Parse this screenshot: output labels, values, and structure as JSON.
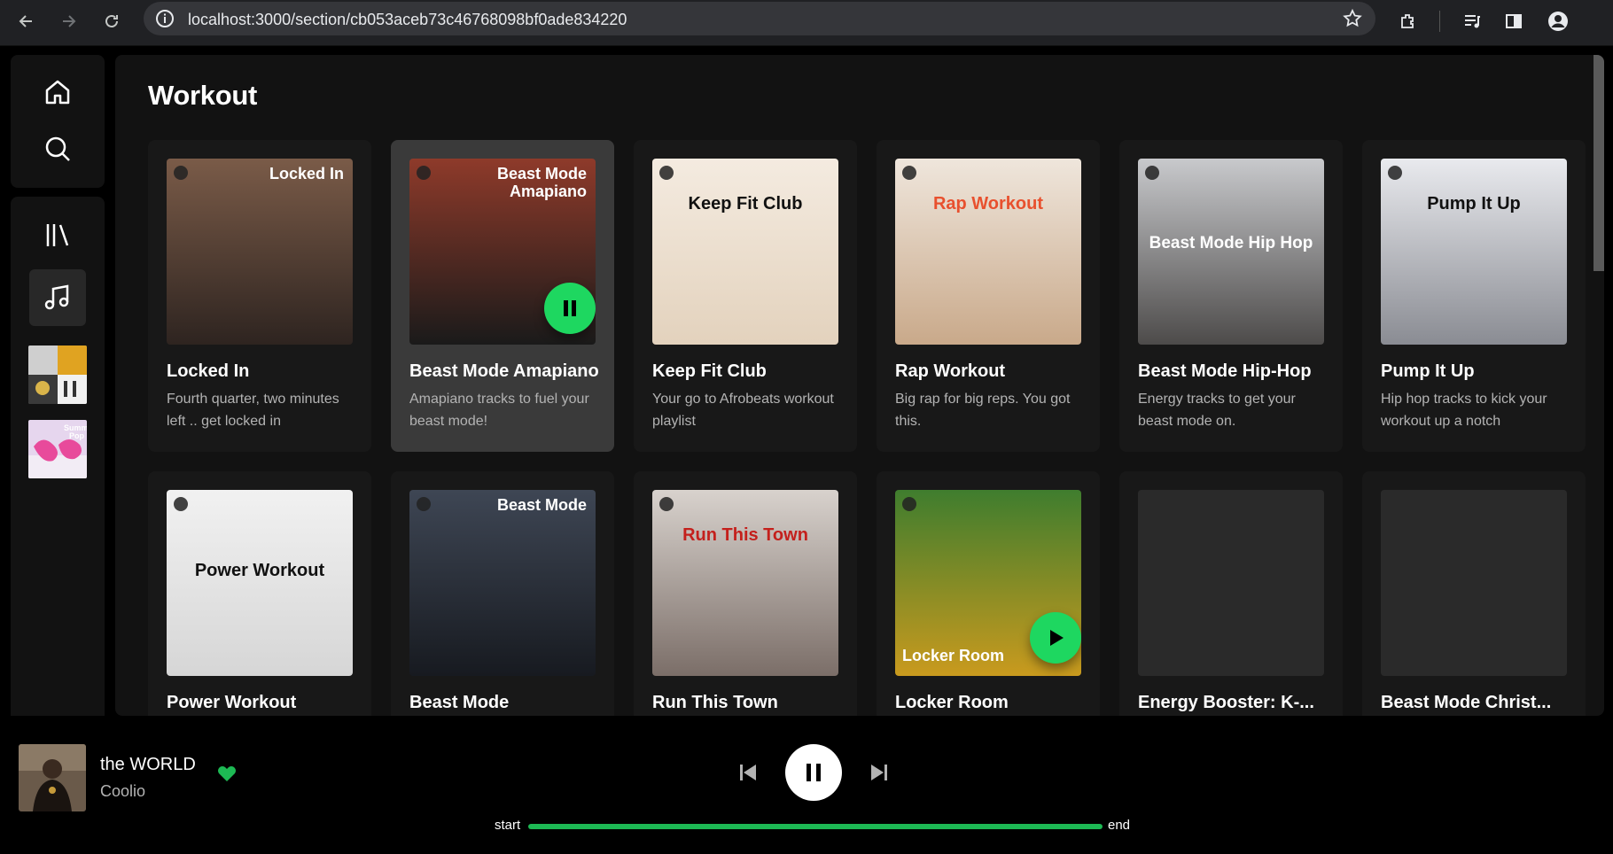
{
  "browser": {
    "url": "localhost:3000/section/cb053aceb73c46768098bf0ade834220"
  },
  "section": {
    "title": "Workout"
  },
  "cards": [
    {
      "name": "Locked In",
      "desc": "Fourth quarter, two minutes left .. get locked in",
      "art_text": "Locked In",
      "palette": [
        "#7a5b48",
        "#2e2420"
      ]
    },
    {
      "name": "Beast Mode Amapiano",
      "desc": "Amapiano tracks to fuel your beast mode!",
      "art_text": "Beast Mode Amapiano",
      "palette": [
        "#8e3a2a",
        "#1a1a1a"
      ]
    },
    {
      "name": "Keep Fit Club",
      "desc": "Your go to Afrobeats workout playlist",
      "art_text": "Keep Fit Club",
      "palette": [
        "#f4ebe0",
        "#e3d2bd"
      ]
    },
    {
      "name": "Rap Workout",
      "desc": "Big rap for big reps. You got this.",
      "art_text": "Rap Workout",
      "palette": [
        "#efe6dc",
        "#c9a98a"
      ]
    },
    {
      "name": "Beast Mode Hip-Hop",
      "desc": "Energy tracks to get your beast mode on.",
      "art_text": "Beast Mode Hip Hop",
      "palette": [
        "#c8c9cc",
        "#4d4b4a"
      ]
    },
    {
      "name": "Pump It Up",
      "desc": "Hip hop tracks to kick your workout up a notch",
      "art_text": "Pump It Up",
      "palette": [
        "#e9eaee",
        "#8a8c93"
      ]
    },
    {
      "name": "Power Workout",
      "desc": "",
      "art_text": "Power Workout",
      "palette": [
        "#f1f1f1",
        "#d6d6d6"
      ]
    },
    {
      "name": "Beast Mode",
      "desc": "",
      "art_text": "Beast Mode",
      "palette": [
        "#3e4654",
        "#171a20"
      ]
    },
    {
      "name": "Run This Town",
      "desc": "",
      "art_text": "Run This Town",
      "palette": [
        "#d8d2cd",
        "#7b6e68"
      ]
    },
    {
      "name": "Locker Room",
      "desc": "",
      "art_text": "Locker Room",
      "palette": [
        "#3f7d2e",
        "#c99a1e"
      ]
    },
    {
      "name": "Energy Booster: K-...",
      "desc": "",
      "art_text": "",
      "palette": [
        "#2a2a2a",
        "#2a2a2a"
      ]
    },
    {
      "name": "Beast Mode Christ...",
      "desc": "",
      "art_text": "",
      "palette": [
        "#2a2a2a",
        "#2a2a2a"
      ]
    }
  ],
  "player": {
    "title": "the WORLD",
    "artist": "Coolio",
    "start_label": "start",
    "end_label": "end",
    "progress": 1.0,
    "accent": "#1db954"
  },
  "icons": [
    "back-icon",
    "forward-icon",
    "reload-icon",
    "info-icon",
    "star-icon",
    "extensions-icon",
    "media-icon",
    "sidepanel-icon",
    "profile-icon",
    "home-icon",
    "search-icon",
    "library-icon",
    "music-note-icon",
    "heart-icon",
    "previous-icon",
    "pause-icon",
    "next-icon",
    "play-icon"
  ]
}
